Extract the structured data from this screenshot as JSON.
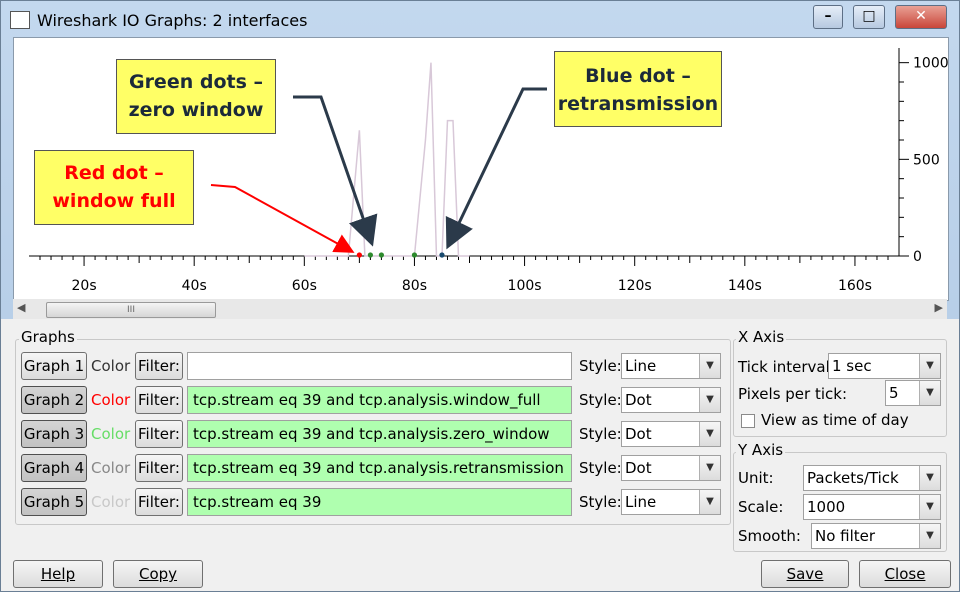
{
  "window": {
    "title": "Wireshark IO Graphs: 2 interfaces"
  },
  "callouts": {
    "green": "Green dots –\nzero window",
    "blue": "Blue dot –\nretransmission",
    "red": "Red dot –\nwindow full"
  },
  "chart_data": {
    "type": "line",
    "x_ticks": [
      "20s",
      "40s",
      "60s",
      "80s",
      "100s",
      "120s",
      "140s",
      "160s"
    ],
    "y_ticks": [
      "1000",
      "500",
      "0"
    ],
    "xlim": [
      10,
      168
    ],
    "ylim": [
      0,
      1050
    ],
    "series": [
      {
        "name": "Graph 5",
        "color": "#d8c8d8",
        "style": "Line",
        "x": [
          60,
          62,
          64,
          66,
          68,
          70,
          71,
          72,
          74,
          76,
          78,
          80,
          82,
          83,
          84,
          85,
          86,
          87,
          88,
          89,
          90
        ],
        "y": [
          0,
          0,
          0,
          0,
          0,
          650,
          0,
          0,
          0,
          0,
          0,
          0,
          600,
          1000,
          0,
          0,
          700,
          700,
          0,
          0,
          0
        ]
      },
      {
        "name": "Graph 2",
        "color": "#ff0000",
        "style": "Dot",
        "x": [
          70
        ],
        "y": [
          0
        ]
      },
      {
        "name": "Graph 3",
        "color": "#2e8b2e",
        "style": "Dot",
        "x": [
          72,
          74,
          80
        ],
        "y": [
          0,
          0,
          0
        ]
      },
      {
        "name": "Graph 4",
        "color": "#1a4a6e",
        "style": "Dot",
        "x": [
          85
        ],
        "y": [
          0
        ]
      }
    ]
  },
  "graphs_group": {
    "legend": "Graphs"
  },
  "graphs": [
    {
      "button": "Graph 1",
      "color_label": "Color",
      "color": "#333333",
      "filter_btn": "Filter:",
      "filter": "",
      "style_label": "Style:",
      "style": "Line",
      "active": false
    },
    {
      "button": "Graph 2",
      "color_label": "Color",
      "color": "#ff0000",
      "filter_btn": "Filter:",
      "filter": "tcp.stream eq 39 and tcp.analysis.window_full",
      "style_label": "Style:",
      "style": "Dot",
      "active": true
    },
    {
      "button": "Graph 3",
      "color_label": "Color",
      "color": "#66dd66",
      "filter_btn": "Filter:",
      "filter": "tcp.stream eq 39 and tcp.analysis.zero_window",
      "style_label": "Style:",
      "style": "Dot",
      "active": true
    },
    {
      "button": "Graph 4",
      "color_label": "Color",
      "color": "#888888",
      "filter_btn": "Filter:",
      "filter": "tcp.stream eq 39 and tcp.analysis.retransmission",
      "style_label": "Style:",
      "style": "Dot",
      "active": true
    },
    {
      "button": "Graph 5",
      "color_label": "Color",
      "color": "#c8c8c8",
      "filter_btn": "Filter:",
      "filter": "tcp.stream eq 39",
      "style_label": "Style:",
      "style": "Line",
      "active": true
    }
  ],
  "x_axis": {
    "legend": "X Axis",
    "tick_interval_label": "Tick interval:",
    "tick_interval": "1 sec",
    "pixels_label": "Pixels per tick:",
    "pixels": "5",
    "time_of_day_label": "View as time of day"
  },
  "y_axis": {
    "legend": "Y Axis",
    "unit_label": "Unit:",
    "unit": "Packets/Tick",
    "scale_label": "Scale:",
    "scale": "1000",
    "smooth_label": "Smooth:",
    "smooth": "No filter"
  },
  "buttons": {
    "help": "Help",
    "copy": "Copy",
    "save": "Save",
    "close": "Close"
  },
  "title_buttons": {
    "minimize": "–",
    "maximize": "□",
    "close": "✕"
  }
}
